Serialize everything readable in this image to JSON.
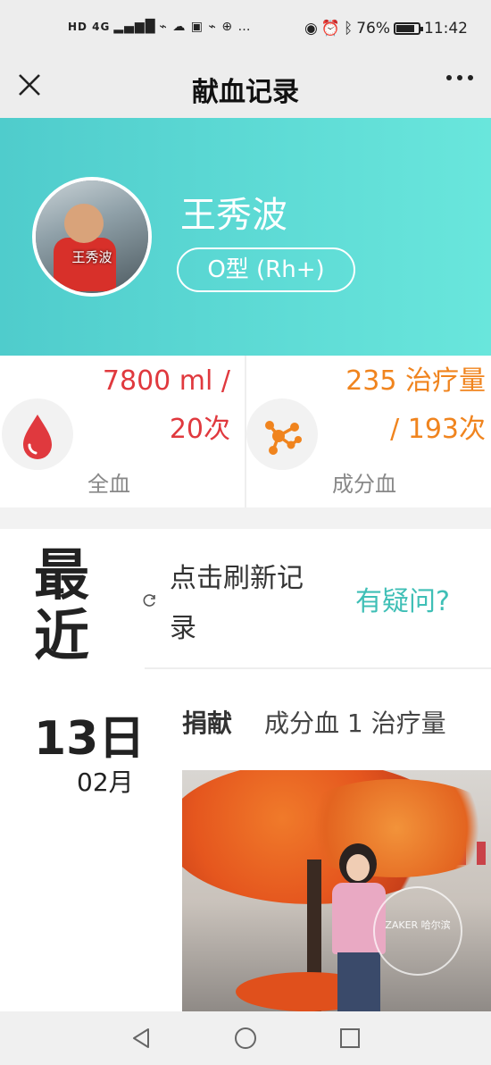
{
  "status_bar": {
    "network": "HD 4G",
    "battery": "76%",
    "time": "11:42"
  },
  "nav": {
    "title": "献血记录"
  },
  "profile": {
    "name": "王秀波",
    "avatar_label": "王秀波",
    "blood_type": "O型 (Rh+)"
  },
  "stats": {
    "whole_blood": {
      "value_line1": "7800 ml /",
      "value_line2": "20次",
      "label": "全血",
      "color": "#e0393e",
      "icon": "blood-drop-icon"
    },
    "component_blood": {
      "value_line1": "235 治疗量",
      "value_line2": "/ 193次",
      "label": "成分血",
      "color": "#f0841e",
      "icon": "molecule-icon"
    }
  },
  "recent": {
    "label": "最近",
    "refresh_text": "点击刷新记录",
    "refresh_icon": "refresh-icon",
    "question_link": "有疑问?",
    "accent": "#3fbfb6"
  },
  "record": {
    "day": "13日",
    "month": "02月",
    "type": "捐献",
    "detail": "成分血 1 治疗量",
    "photo_watermark": "ZAKER 哈尔滨"
  }
}
